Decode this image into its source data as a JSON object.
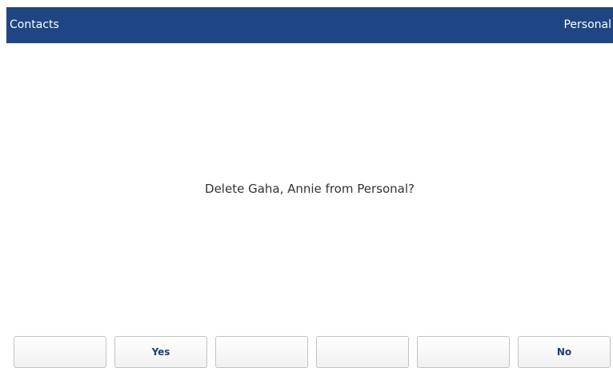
{
  "header": {
    "title": "Contacts",
    "context": "Personal"
  },
  "dialog": {
    "message": "Delete Gaha, Annie from Personal?"
  },
  "softkeys": {
    "key1": "",
    "key2": "Yes",
    "key3": "",
    "key4": "",
    "key5": "",
    "key6": "No"
  },
  "colors": {
    "header_bg": "#1e4682",
    "header_text": "#ffffff",
    "softkey_text": "#1e3c78"
  }
}
